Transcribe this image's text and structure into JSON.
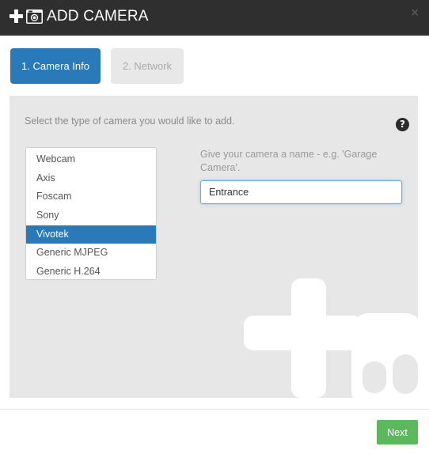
{
  "header": {
    "icons": [
      "plus-icon",
      "camera-icon"
    ],
    "title": "ADD CAMERA",
    "close_label": "×"
  },
  "tabs": [
    {
      "label": "1. Camera Info",
      "active": true
    },
    {
      "label": "2. Network",
      "active": false
    }
  ],
  "panel": {
    "instruction": "Select the type of camera you would like to add.",
    "help_label": "?",
    "camera_types": [
      "Webcam",
      "Axis",
      "Foscam",
      "Sony",
      "Vivotek",
      "Generic MJPEG",
      "Generic H.264"
    ],
    "selected_type": "Vivotek",
    "name_label": "Give your camera a name - e.g. 'Garage Camera'.",
    "name_value": "Entrance"
  },
  "footer": {
    "next_label": "Next"
  },
  "colors": {
    "header_bg": "#2f2f2f",
    "accent": "#2a7ab9",
    "panel_bg": "#e7e7e7",
    "next_button": "#5cb85c"
  }
}
